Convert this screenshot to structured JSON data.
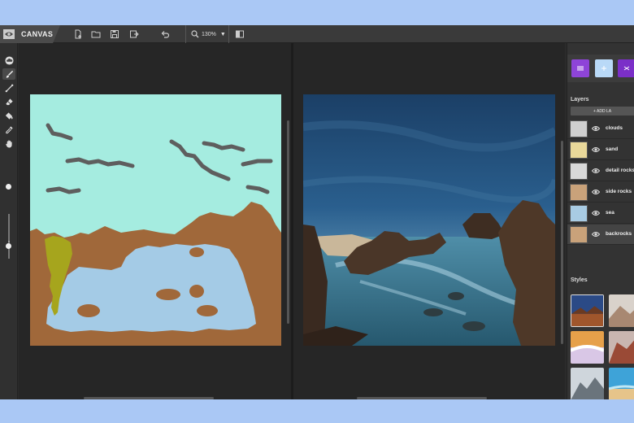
{
  "app": {
    "name": "CANVAS"
  },
  "toolbar": {
    "zoom_value": "130%",
    "icons": [
      "new-file-icon",
      "open-folder-icon",
      "save-icon",
      "export-icon",
      "undo-icon",
      "zoom-icon",
      "chevron-down-icon",
      "split-view-icon"
    ]
  },
  "tools": [
    "cloud-brush-icon",
    "brush-icon",
    "line-icon",
    "eraser-icon",
    "fill-icon",
    "eyedropper-icon",
    "hand-icon"
  ],
  "brush_size": {
    "level": 0.3
  },
  "layers_panel": {
    "title": "Layers",
    "add_label": "+ ADD LA",
    "layers": [
      {
        "name": "clouds"
      },
      {
        "name": "sand"
      },
      {
        "name": "detail rocks"
      },
      {
        "name": "side rocks"
      },
      {
        "name": "sea"
      },
      {
        "name": "backrocks"
      }
    ]
  },
  "styles_panel": {
    "title": "Styles"
  },
  "colors": {
    "sky": "#a5ece0",
    "water": "#a4cbe6",
    "rock": "#a0683a",
    "moss": "#a6a51d",
    "cloud": "#5e5e5e",
    "swatch1": "#8e44d8",
    "swatch2": "#b9d9f7",
    "swatch3": "#7b2fc8"
  }
}
